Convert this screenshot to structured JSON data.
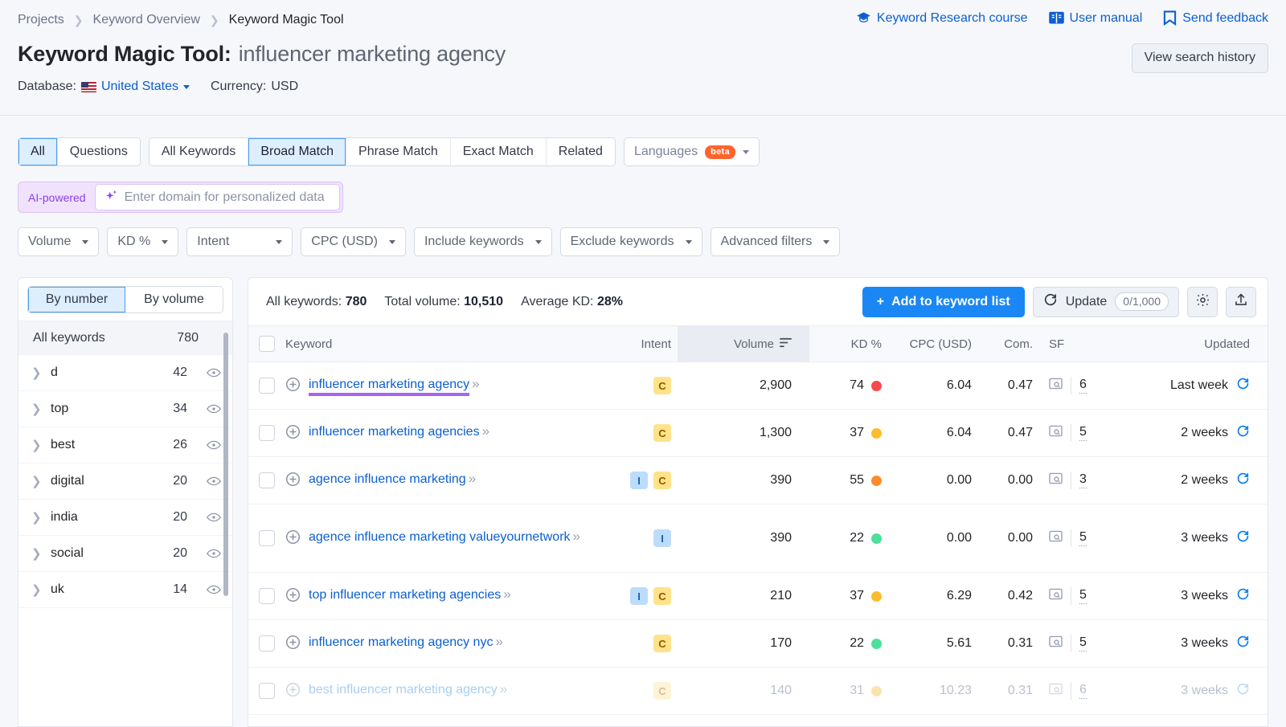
{
  "breadcrumb": [
    "Projects",
    "Keyword Overview",
    "Keyword Magic Tool"
  ],
  "header": {
    "title_prefix": "Keyword Magic Tool:",
    "query": "influencer marketing agency",
    "links": [
      {
        "label": "Keyword Research course",
        "icon": "graduation-cap-icon"
      },
      {
        "label": "User manual",
        "icon": "book-icon"
      },
      {
        "label": "Send feedback",
        "icon": "flag-icon"
      }
    ],
    "view_history": "View search history",
    "database_label": "Database:",
    "database_value": "United States",
    "currency_label": "Currency:",
    "currency_value": "USD"
  },
  "tabs": {
    "group1": [
      {
        "label": "All",
        "active": true
      },
      {
        "label": "Questions",
        "active": false
      }
    ],
    "group2": [
      {
        "label": "All Keywords",
        "active": false
      },
      {
        "label": "Broad Match",
        "active": true
      },
      {
        "label": "Phrase Match",
        "active": false
      },
      {
        "label": "Exact Match",
        "active": false
      },
      {
        "label": "Related",
        "active": false
      }
    ],
    "languages": {
      "label": "Languages",
      "badge": "beta"
    }
  },
  "ai_bar": {
    "label": "AI-powered",
    "placeholder": "Enter domain for personalized data",
    "accent": "#8b3fe8"
  },
  "filters": [
    "Volume",
    "KD %",
    "Intent",
    "CPC (USD)",
    "Include keywords",
    "Exclude keywords",
    "Advanced filters"
  ],
  "sidebar": {
    "segments": [
      {
        "label": "By number",
        "active": true
      },
      {
        "label": "By volume",
        "active": false
      }
    ],
    "all_keywords_label": "All keywords",
    "all_keywords_count": "780",
    "groups": [
      {
        "name": "d",
        "count": "42"
      },
      {
        "name": "top",
        "count": "34"
      },
      {
        "name": "best",
        "count": "26"
      },
      {
        "name": "digital",
        "count": "20"
      },
      {
        "name": "india",
        "count": "20"
      },
      {
        "name": "social",
        "count": "20"
      },
      {
        "name": "uk",
        "count": "14"
      }
    ]
  },
  "main": {
    "stats": [
      {
        "label": "All keywords:",
        "value": "780"
      },
      {
        "label": "Total volume:",
        "value": "10,510"
      },
      {
        "label": "Average KD:",
        "value": "28%"
      }
    ],
    "add_button": "Add to keyword list",
    "update_button": "Update",
    "update_count": "0/1,000",
    "columns": {
      "keyword": "Keyword",
      "intent": "Intent",
      "volume": "Volume",
      "kd": "KD %",
      "cpc": "CPC (USD)",
      "com": "Com.",
      "sf": "SF",
      "updated": "Updated"
    },
    "rows": [
      {
        "keyword": "influencer marketing agency",
        "highlight": true,
        "intent": [
          "C"
        ],
        "volume": "2,900",
        "kd": "74",
        "kd_color": "#f7484e",
        "cpc": "6.04",
        "com": "0.47",
        "sf": "6",
        "updated": "Last week",
        "faded": false
      },
      {
        "keyword": "influencer marketing agencies",
        "highlight": false,
        "intent": [
          "C"
        ],
        "volume": "1,300",
        "kd": "37",
        "kd_color": "#fdbc2c",
        "cpc": "6.04",
        "com": "0.47",
        "sf": "5",
        "updated": "2 weeks",
        "faded": false
      },
      {
        "keyword": "agence influence marketing",
        "highlight": false,
        "intent": [
          "I",
          "C"
        ],
        "volume": "390",
        "kd": "55",
        "kd_color": "#fd8b2c",
        "cpc": "0.00",
        "com": "0.00",
        "sf": "3",
        "updated": "2 weeks",
        "faded": false
      },
      {
        "keyword": "agence influence marketing valueyournetwork",
        "highlight": false,
        "intent": [
          "I"
        ],
        "volume": "390",
        "kd": "22",
        "kd_color": "#4ce09b",
        "cpc": "0.00",
        "com": "0.00",
        "sf": "5",
        "updated": "3 weeks",
        "faded": false
      },
      {
        "keyword": "top influencer marketing agencies",
        "highlight": false,
        "intent": [
          "I",
          "C"
        ],
        "volume": "210",
        "kd": "37",
        "kd_color": "#fdbc2c",
        "cpc": "6.29",
        "com": "0.42",
        "sf": "5",
        "updated": "3 weeks",
        "faded": false
      },
      {
        "keyword": "influencer marketing agency nyc",
        "highlight": false,
        "intent": [
          "C"
        ],
        "volume": "170",
        "kd": "22",
        "kd_color": "#4ce09b",
        "cpc": "5.61",
        "com": "0.31",
        "sf": "5",
        "updated": "3 weeks",
        "faded": false
      },
      {
        "keyword": "best influencer marketing agency",
        "highlight": false,
        "intent": [
          "C"
        ],
        "volume": "140",
        "kd": "31",
        "kd_color": "#fae3ae",
        "cpc": "10.23",
        "com": "0.31",
        "sf": "6",
        "updated": "3 weeks",
        "faded": true
      }
    ]
  }
}
